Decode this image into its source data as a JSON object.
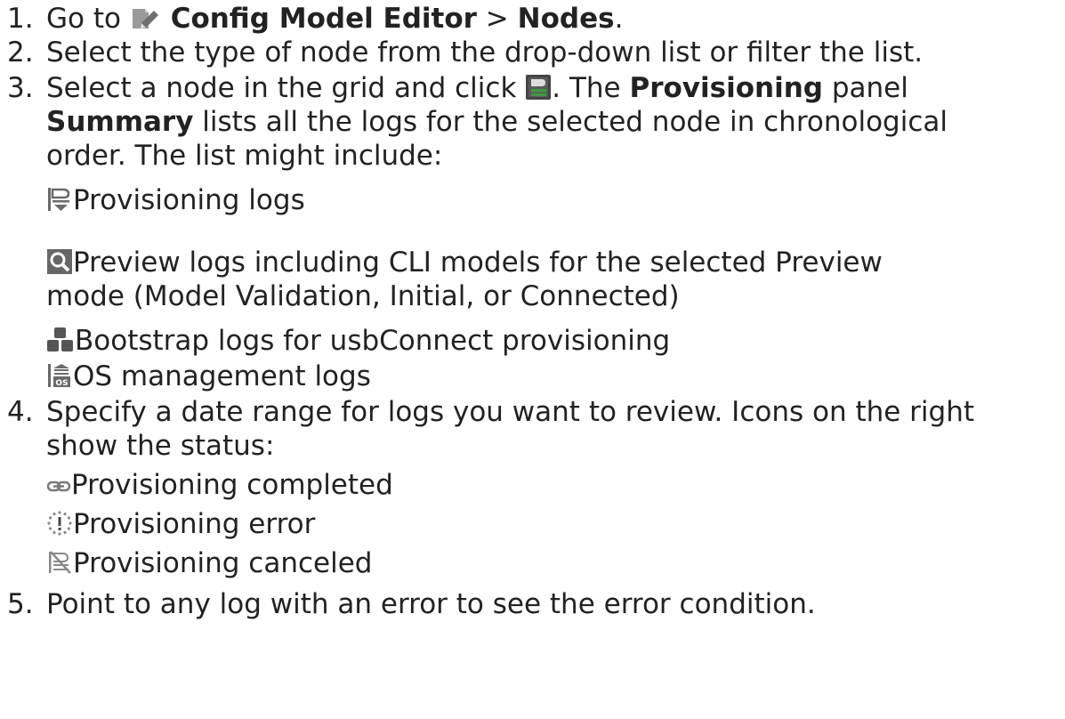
{
  "steps": [
    {
      "number": "1.",
      "prefix": "Go to ",
      "icon": "config-model-editor-icon",
      "bold1": "Config Model Editor",
      "sep": " > ",
      "bold2": "Nodes",
      "suffix": "."
    },
    {
      "number": "2.",
      "text": "Select the type of node from the drop-down list or filter the list."
    },
    {
      "number": "3.",
      "text_a": "Select a node in the grid and click ",
      "icon": "provisioning-panel-icon",
      "text_b": ". The ",
      "bold_a": "Provisioning",
      "text_c": " panel",
      "bold_b": "Summary",
      "text_d": " lists all the logs for the selected node in chronological",
      "text_e": "order. The list might include:",
      "log_types": [
        {
          "icon": "provisioning-logs-icon",
          "text": "Provisioning logs"
        },
        {
          "icon": "preview-logs-icon",
          "text": "Preview logs including CLI models for the selected Preview",
          "text2": "mode (Model Validation, Initial, or Connected)"
        },
        {
          "icon": "bootstrap-logs-icon",
          "text": "Bootstrap logs for usbConnect provisioning"
        },
        {
          "icon": "os-management-logs-icon",
          "text": "OS management logs"
        }
      ]
    },
    {
      "number": "4.",
      "text": "Specify a date range for logs you want to review. Icons on the right",
      "text2": "show the status:",
      "statuses": [
        {
          "icon": "link-icon",
          "text": "Provisioning completed"
        },
        {
          "icon": "error-burst-icon",
          "text": "Provisioning error"
        },
        {
          "icon": "canceled-icon",
          "text": "Provisioning canceled"
        }
      ]
    },
    {
      "number": "5.",
      "text": "Point to any log with an error to see the error condition."
    }
  ],
  "colors": {
    "text": "#222222",
    "icon_gray": "#7a7a7a",
    "icon_green": "#3d9a3d",
    "icon_dark": "#444444"
  }
}
